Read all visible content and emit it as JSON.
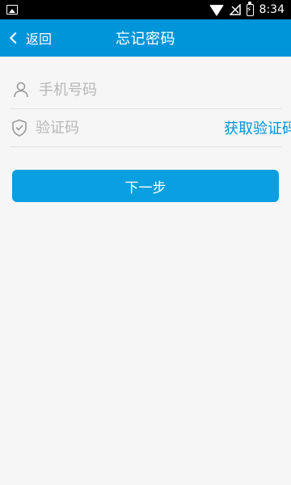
{
  "status_bar": {
    "time": "8:34",
    "icons": [
      "image-icon",
      "wifi-icon",
      "signal-icon",
      "battery-charging-icon"
    ]
  },
  "header": {
    "back_label": "返回",
    "title": "忘记密码",
    "background_color": "#0095d9"
  },
  "form": {
    "phone_placeholder": "手机号码",
    "code_placeholder": "验证码",
    "get_code_label": "获取验证码"
  },
  "actions": {
    "next_label": "下一步",
    "button_color": "#0a9fe0"
  }
}
